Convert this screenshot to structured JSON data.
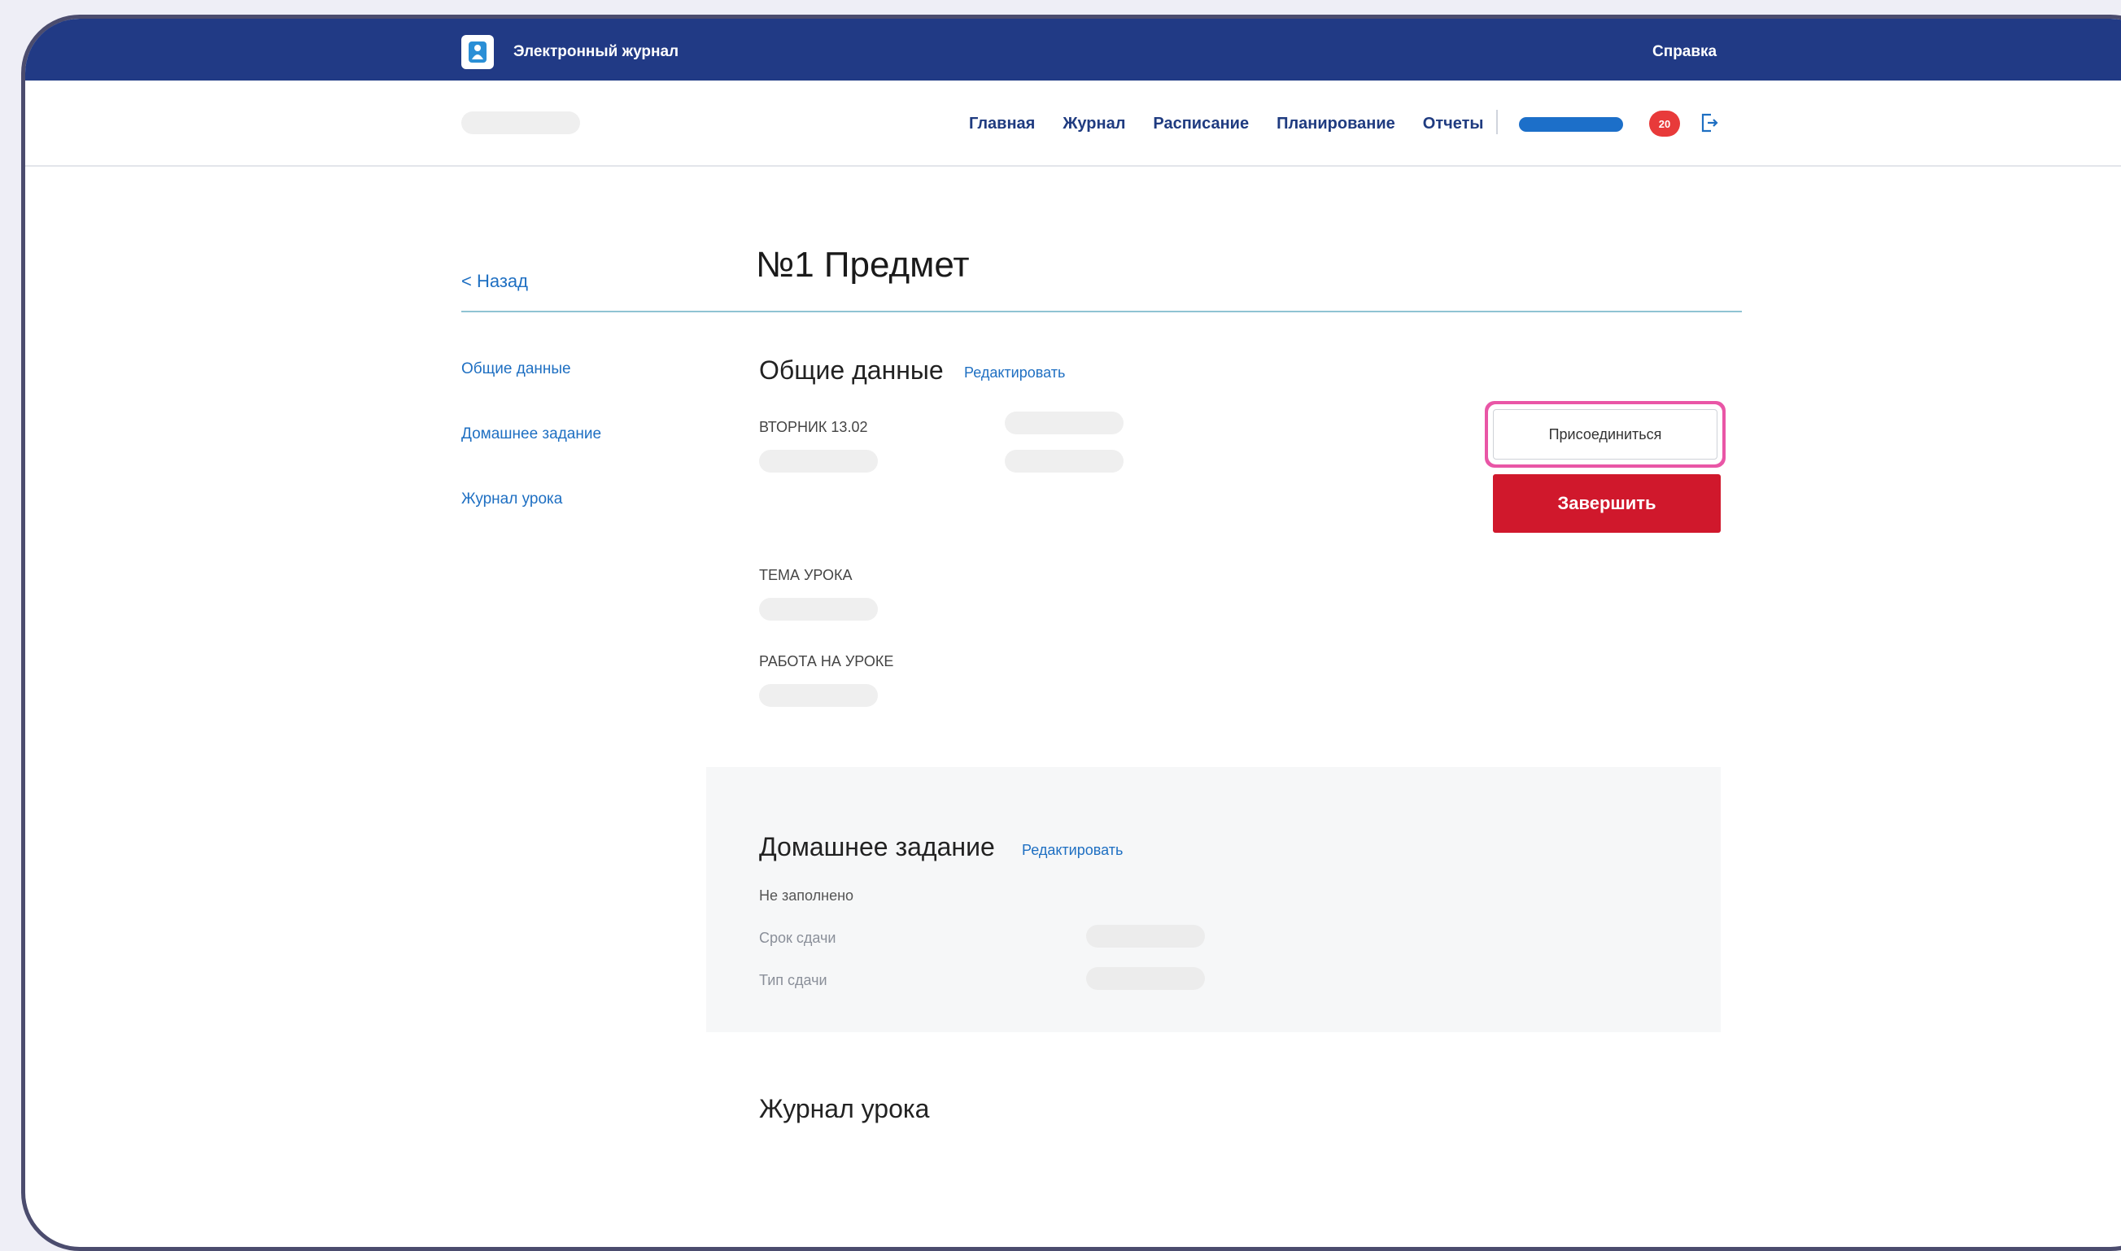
{
  "app": {
    "title": "Электронный журнал",
    "help_label": "Справка"
  },
  "nav": {
    "links": [
      "Главная",
      "Журнал",
      "Расписание",
      "Планирование",
      "Отчеты"
    ],
    "notifications_count": "20"
  },
  "page": {
    "back_label": "< Назад",
    "title": "№1 Предмет"
  },
  "sidebar": {
    "items": [
      {
        "label": "Общие данные"
      },
      {
        "label": "Домашнее задание"
      },
      {
        "label": "Журнал урока"
      }
    ]
  },
  "general": {
    "title": "Общие данные",
    "edit_label": "Редактировать",
    "day_label": "ВТОРНИК 13.02",
    "topic_label": "ТЕМА УРОКА",
    "work_label": "РАБОТА НА УРОКЕ",
    "join_label": "Присоединиться",
    "finish_label": "Завершить"
  },
  "homework": {
    "title": "Домашнее задание",
    "edit_label": "Редактировать",
    "status": "Не заполнено",
    "deadline_label": "Срок сдачи",
    "type_label": "Тип сдачи"
  },
  "journal": {
    "title": "Журнал урока"
  },
  "colors": {
    "header": "#213a85",
    "link": "#1e6fc2",
    "finish": "#d0182c",
    "highlight": "#e956a6",
    "badge": "#e83a3a"
  }
}
